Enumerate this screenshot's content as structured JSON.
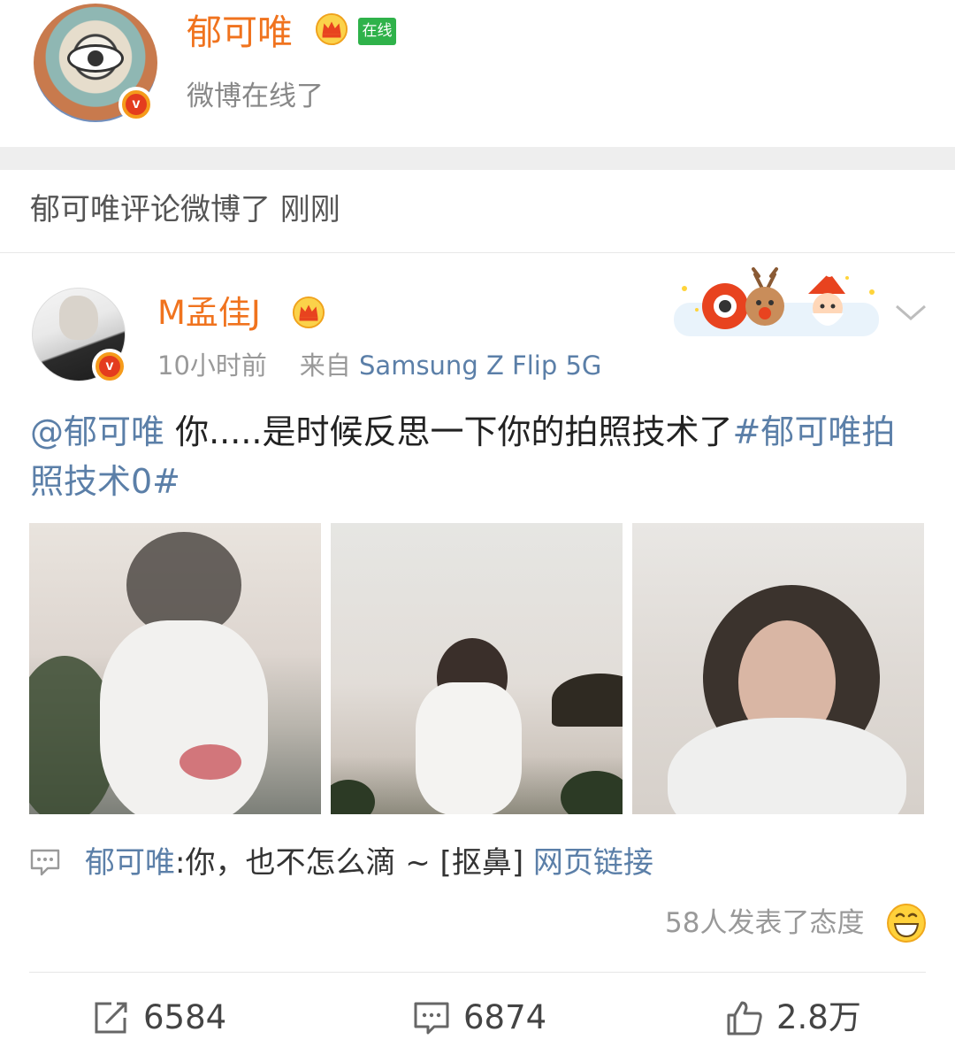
{
  "profile": {
    "name": "郁可唯",
    "online_badge": "在线",
    "status": "微博在线了"
  },
  "activity": {
    "text": "郁可唯评论微博了 刚刚"
  },
  "post": {
    "author": "M孟佳J",
    "time": "10小时前",
    "source_prefix": "来自",
    "source": "Samsung Z Flip 5G",
    "text_mention": "@郁可唯",
    "text_body": " 你.....是时候反思一下你的拍照技术了",
    "text_hashtag": "#郁可唯拍照技术0#",
    "photos_count": 3
  },
  "comment": {
    "author": "郁可唯",
    "body": ":你，也不怎么滴 ~ [抠鼻] ",
    "link": "网页链接"
  },
  "reactions": {
    "text": "58人发表了态度"
  },
  "actions": {
    "repost_count": "6584",
    "comment_count": "6874",
    "like_count": "2.8万"
  },
  "colors": {
    "name_orange": "#f0731e",
    "link_blue": "#5b7fa8",
    "online_green": "#2fb24a"
  },
  "icons": [
    "crown-icon",
    "verified-icon",
    "chevron-down-icon",
    "comment-icon",
    "smile-emoji-icon",
    "repost-icon",
    "like-icon"
  ]
}
